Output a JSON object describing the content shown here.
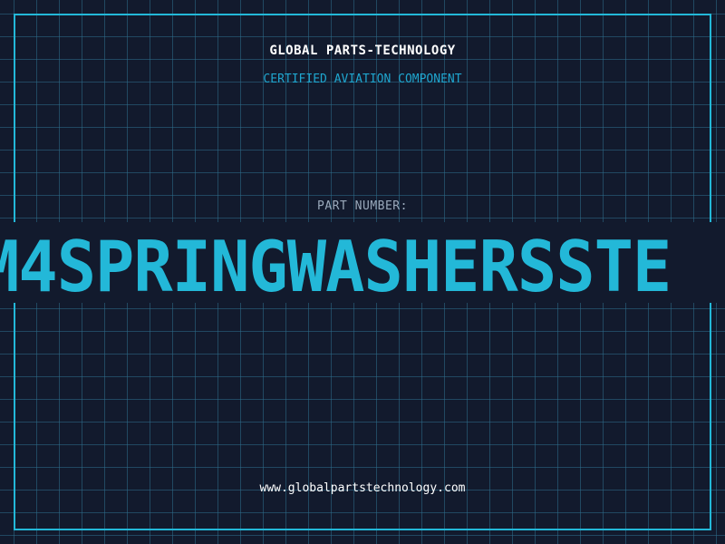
{
  "header": {
    "company": "GLOBAL PARTS-TECHNOLOGY",
    "tagline": "CERTIFIED AVIATION COMPONENT"
  },
  "part": {
    "label": "PART NUMBER:",
    "number": "M4SPRINGWASHERSSTE"
  },
  "footer": {
    "url": "www.globalpartstechnology.com"
  },
  "colors": {
    "background": "#121a2d",
    "grid": "#2e6e8c",
    "accent": "#23b8d8",
    "text_primary": "#ffffff",
    "text_muted": "#9aa9bb"
  }
}
